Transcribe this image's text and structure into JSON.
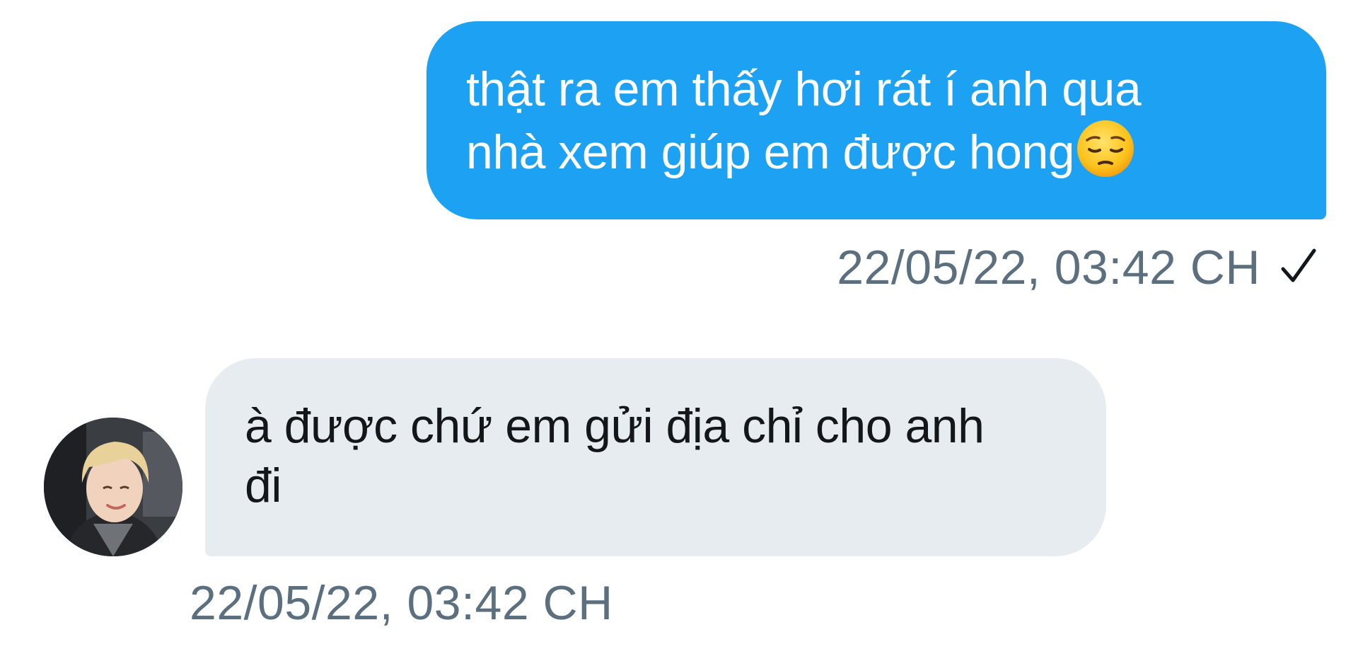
{
  "messages": [
    {
      "direction": "outgoing",
      "line1": "thật ra em thấy hơi rát í anh qua",
      "line2": "nhà xem giúp em được hong",
      "emoji": "pensive-face",
      "timestamp": "22/05/22, 03:42 CH",
      "status_icon": "checkmark-icon"
    },
    {
      "direction": "incoming",
      "line1": "à được chứ em gửi địa chỉ cho anh",
      "line2": "đi",
      "timestamp": "22/05/22, 03:42 CH",
      "avatar": "user-avatar"
    }
  ],
  "colors": {
    "outgoing_bubble": "#1da1f2",
    "incoming_bubble": "#e6ecf0",
    "outgoing_text": "#ffffff",
    "incoming_text": "#14171a",
    "timestamp_text": "#5b6f7e",
    "background": "#ffffff"
  }
}
